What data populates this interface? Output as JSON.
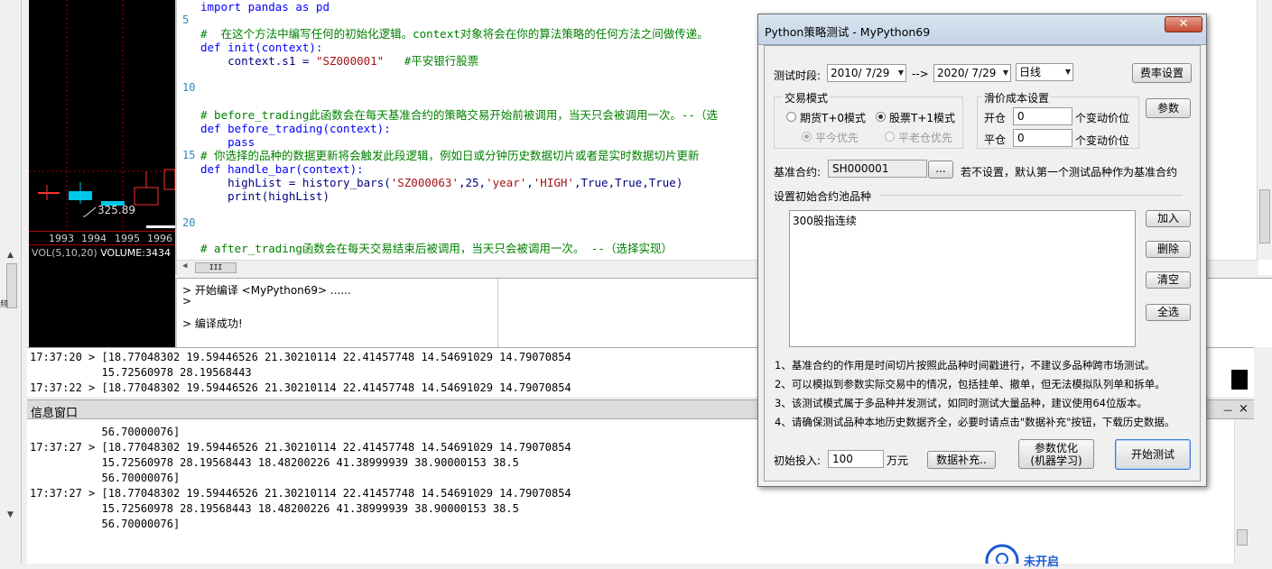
{
  "left_strip": {
    "side_text": "频"
  },
  "chart": {
    "years": [
      "1993",
      "1994",
      "1995",
      "1996"
    ],
    "price_label": "325.89",
    "vol_label": "VOL(5,10,20)",
    "volume_label": "VOLUME:3434"
  },
  "editor": {
    "line_numbers": {
      "l5": "5",
      "l10": "10",
      "l15": "15",
      "l20": "20"
    },
    "lines": {
      "import": "import pandas as pd",
      "comment_init": "#  在这个方法中编写任何的初始化逻辑。context对象将会在你的算法策略的任何方法之间做传递。",
      "def_init": "def init(context):",
      "context_s1_code": "    context.s1 = ",
      "context_s1_str": "\"SZ000001\"",
      "context_s1_comment": "   #平安银行股票",
      "comment_before": "# before_trading此函数会在每天基准合约的策略交易开始前被调用，当天只会被调用一次。--（选",
      "def_before": "def before_trading(context):",
      "pass": "    pass",
      "comment_handle": "# 你选择的品种的数据更新将会触发此段逻辑，例如日或分钟历史数据切片或者是实时数据切片更新",
      "def_handle": "def handle_bar(context):",
      "highlist_a": "    highList = history_bars(",
      "highlist_s1": "'SZ000063'",
      "highlist_b": ",25,",
      "highlist_s2": "'year'",
      "highlist_c": ",",
      "highlist_s3": "'HIGH'",
      "highlist_d": ",True,True,True)",
      "print": "    print(highList)",
      "comment_after": "# after_trading函数会在每天交易结束后被调用，当天只会被调用一次。 --（选择实现）"
    },
    "hscroll_thumb": "III"
  },
  "compile_output": {
    "line1": "> 开始编译 <MyPython69> ......",
    "line2": ">",
    "line3": "> 编译成功!"
  },
  "log_upper": {
    "l1": "17:37:20 > [18.77048302 19.59446526 21.30210114 22.41457748 14.54691029 14.79070854",
    "l2": "           15.72560978 28.19568443",
    "l3": "17:37:22 > [18.77048302 19.59446526 21.30210114 22.41457748 14.54691029 14.79070854"
  },
  "info_window": {
    "title": "信息窗口",
    "pin": "ᅳ",
    "close": "×",
    "lines": [
      "           56.70000076]",
      "17:37:27 > [18.77048302 19.59446526 21.30210114 22.41457748 14.54691029 14.79070854",
      "           15.72560978 28.19568443 18.48200226 41.38999939 38.90000153 38.5",
      "           56.70000076]",
      "17:37:27 > [18.77048302 19.59446526 21.30210114 22.41457748 14.54691029 14.79070854",
      "           15.72560978 28.19568443 18.48200226 41.38999939 38.90000153 38.5",
      "           56.70000076]"
    ]
  },
  "watermark": {
    "text": "未开启"
  },
  "dialog": {
    "title": "Python策略测试 - MyPython69",
    "close": "✕",
    "test_period_label": "测试时段:",
    "start_date": "2010/ 7/29",
    "arrow": "-->",
    "end_date": "2020/ 7/29",
    "cycle": "日线",
    "fee_button": "费率设置",
    "trade_mode_title": "交易模式",
    "futures_mode": "期货T+0模式",
    "stock_mode": "股票T+1模式",
    "close_today_first": "平今优先",
    "close_old_first": "平老仓优先",
    "slippage_title": "滑价成本设置",
    "open_label": "开仓",
    "open_value": "0",
    "open_unit": "个变动价位",
    "close_label": "平仓",
    "close_value": "0",
    "close_unit": "个变动价位",
    "params_button": "参数",
    "benchmark_label": "基准合约:",
    "benchmark_value": "SH000001",
    "browse_button": "...",
    "benchmark_hint": "若不设置，默认第一个测试品种作为基准合约",
    "pool_title": "设置初始合约池品种",
    "pool_items": [
      "300股指连续"
    ],
    "add_button": "加入",
    "delete_button": "删除",
    "clear_button": "清空",
    "select_all_button": "全选",
    "notes": [
      "1、基准合约的作用是时间切片按照此品种时间戳进行，不建议多品种跨市场测试。",
      "2、可以模拟到参数实际交易中的情况，包括挂单、撤单，但无法模拟队列单和拆单。",
      "3、该测试模式属于多品种并发测试，如同时测试大量品种，建议使用64位版本。",
      "4、请确保测试品种本地历史数据齐全，必要时请点击\"数据补充\"按钮，下载历史数据。"
    ],
    "initial_input_label": "初始投入:",
    "initial_input_value": "100",
    "initial_input_unit": "万元",
    "data_supplement_button": "数据补充..",
    "optimize_button_line1": "参数优化",
    "optimize_button_line2": "(机器学习)",
    "start_test_button": "开始测试"
  }
}
